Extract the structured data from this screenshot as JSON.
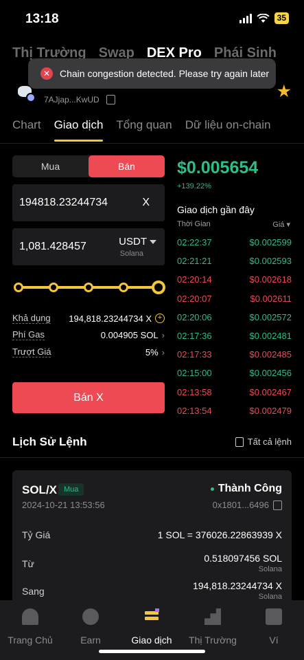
{
  "status_bar": {
    "time": "13:18",
    "battery": "35"
  },
  "top_tabs": [
    "Thị Trường",
    "Swap",
    "DEX Pro",
    "Phái Sinh"
  ],
  "toast": {
    "message": "Chain congestion detected. Please try again later"
  },
  "token": {
    "address": "7AJjap...KwUD"
  },
  "sub_tabs": [
    "Chart",
    "Giao dịch",
    "Tổng quan",
    "Dữ liệu on-chain"
  ],
  "trade_form": {
    "buy_label": "Mua",
    "sell_label": "Bán",
    "amount_value": "194818.23244734",
    "amount_unit": "X",
    "total_value": "1,081.428457",
    "total_unit": "USDT",
    "total_network": "Solana",
    "slider_percent": 100,
    "available_label": "Khả dụng",
    "available_value": "194,818.23244734 X",
    "gas_label": "Phí Gas",
    "gas_value": "0.004905 SOL",
    "slippage_label": "Trượt Giá",
    "slippage_value": "5%",
    "submit_label": "Bán X"
  },
  "market": {
    "price": "$0.005654",
    "change": "+139.22%",
    "recent_title": "Giao dịch gần đây",
    "time_header": "Thời Gian",
    "price_header": "Giá ▾",
    "trades": [
      {
        "time": "02:22:37",
        "price": "$0.002599",
        "color": "#2ebd85"
      },
      {
        "time": "02:21:21",
        "price": "$0.002593",
        "color": "#2ebd85"
      },
      {
        "time": "02:20:14",
        "price": "$0.002618",
        "color": "#ee4a53"
      },
      {
        "time": "02:20:07",
        "price": "$0.002611",
        "color": "#ee4a53"
      },
      {
        "time": "02:20:06",
        "price": "$0.002572",
        "color": "#2ebd85"
      },
      {
        "time": "02:17:36",
        "price": "$0.002481",
        "color": "#2ebd85"
      },
      {
        "time": "02:17:33",
        "price": "$0.002485",
        "color": "#ee4a53"
      },
      {
        "time": "02:15:00",
        "price": "$0.002456",
        "color": "#2ebd85"
      },
      {
        "time": "02:13:58",
        "price": "$0.002467",
        "color": "#ee4a53"
      },
      {
        "time": "02:13:54",
        "price": "$0.002479",
        "color": "#ee4a53"
      }
    ]
  },
  "history": {
    "title": "Lịch Sử Lệnh",
    "all_label": "Tất cả lệnh",
    "order": {
      "pair": "SOL/X",
      "side": "Mua",
      "status": "Thành Công",
      "date": "2024-10-21 13:53:56",
      "hash": "0x1801...6496",
      "rate_label": "Tỷ Giá",
      "rate_value": "1 SOL = 376026.22863939 X",
      "from_label": "Từ",
      "from_value": "0.518097456 SOL",
      "from_network": "Solana",
      "to_label": "Sang",
      "to_value": "194,818.23244734 X",
      "to_network": "Solana"
    }
  },
  "bottom_nav": [
    "Trang Chủ",
    "Earn",
    "Giao dịch",
    "Thị Trường",
    "Ví"
  ]
}
